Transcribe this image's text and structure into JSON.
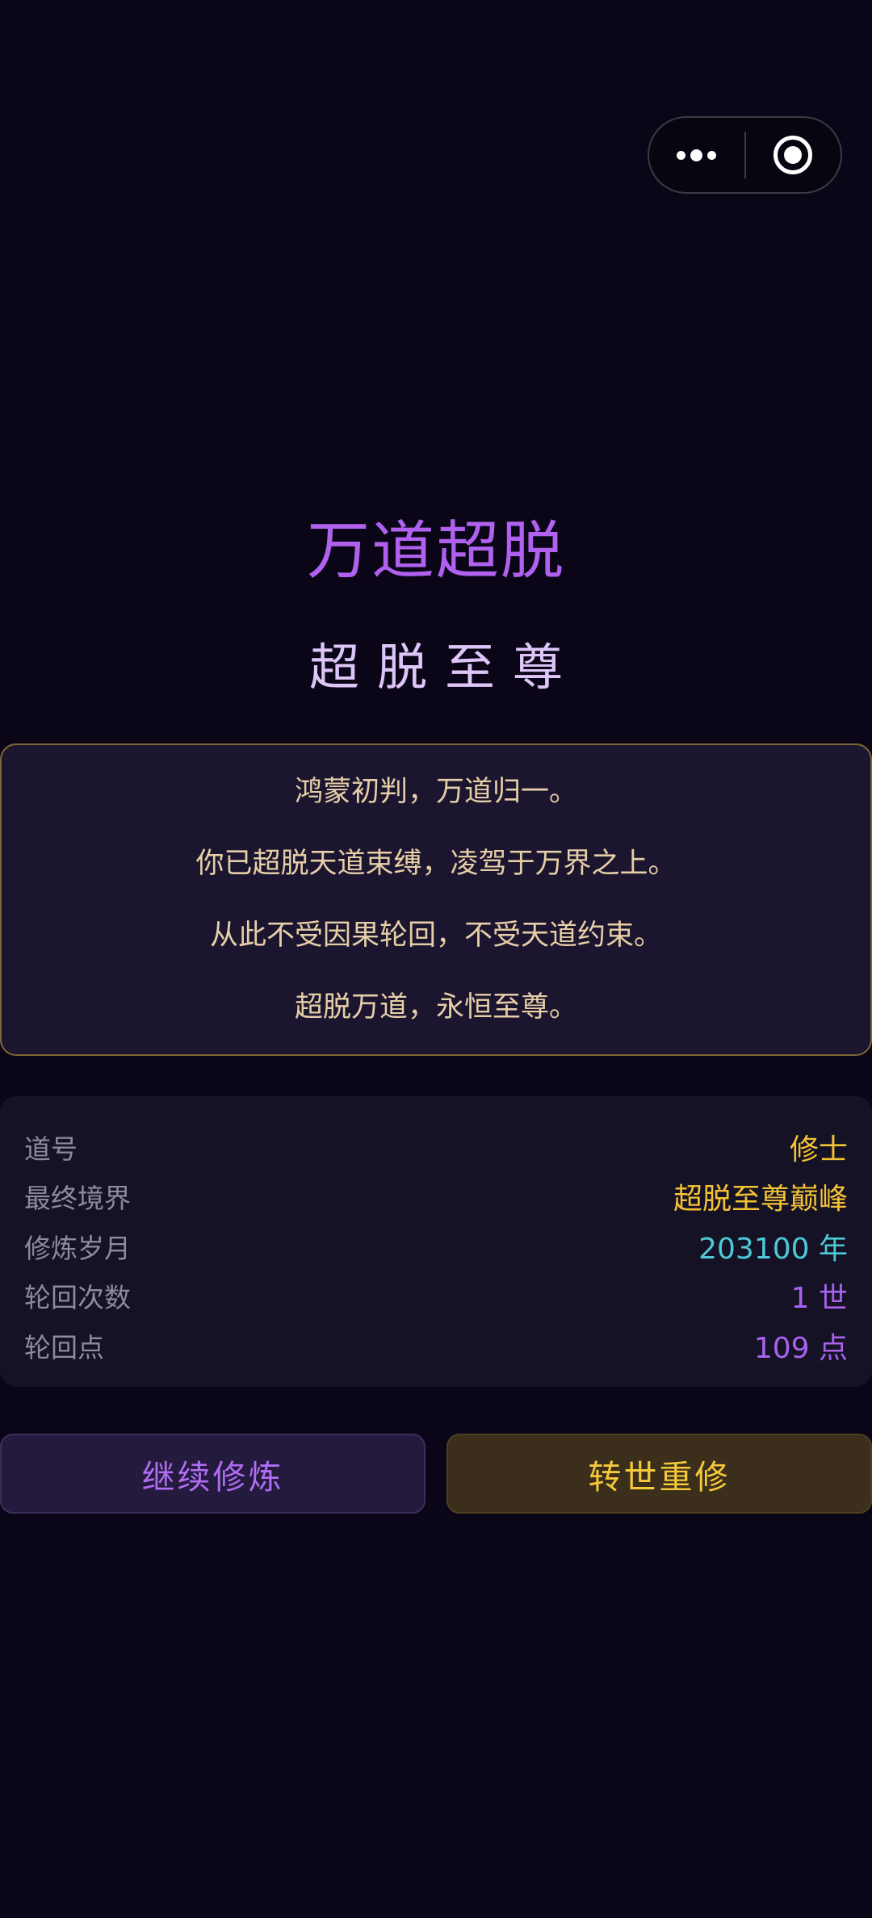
{
  "header": {
    "title": "万道超脱",
    "subtitle": "超脱至尊"
  },
  "poem": {
    "lines": [
      "鸿蒙初判，万道归一。",
      "你已超脱天道束缚，凌驾于万界之上。",
      "从此不受因果轮回，不受天道约束。",
      "超脱万道，永恒至尊。"
    ]
  },
  "stats": [
    {
      "label": "道号",
      "value": "修士",
      "color": "#f4c333"
    },
    {
      "label": "最终境界",
      "value": "超脱至尊巅峰",
      "color": "#f4c333"
    },
    {
      "label": "修炼岁月",
      "value": "203100 年",
      "color": "#4ec9d6"
    },
    {
      "label": "轮回次数",
      "value": "1 世",
      "color": "#a862ee"
    },
    {
      "label": "轮回点",
      "value": "109 点",
      "color": "#a862ee"
    }
  ],
  "buttons": {
    "continue_label": "继续修炼",
    "rebirth_label": "转世重修"
  },
  "capsule": {
    "more_icon": "more-dots-icon",
    "close_icon": "target-circle-icon"
  },
  "colors": {
    "background": "#0a0618",
    "accent_purple": "#b061f0",
    "accent_gold": "#f4c333"
  }
}
